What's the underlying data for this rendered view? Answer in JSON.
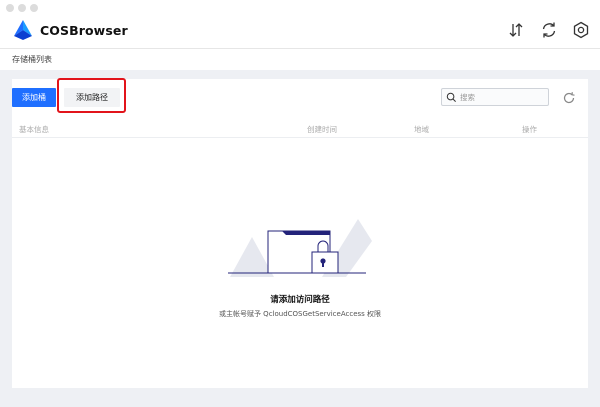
{
  "window": {
    "traffic_lights": [
      "close",
      "minimize",
      "zoom"
    ]
  },
  "header": {
    "app_name": "COSBrowser",
    "logo_icon": "cos-logo-icon",
    "icons": [
      "transfer-icon",
      "sync-icon",
      "settings-icon"
    ]
  },
  "breadcrumb": {
    "label": "存储桶列表"
  },
  "toolbar": {
    "add_bucket_label": "添加桶",
    "add_path_label": "添加路径",
    "search_placeholder": "搜索",
    "refresh_icon": "refresh-icon"
  },
  "table": {
    "columns": [
      "基本信息",
      "创建时间",
      "地域",
      "操作"
    ]
  },
  "empty_state": {
    "title": "请添加访问路径",
    "subtitle": "或主帐号赋予 QcloudCOSGetServiceAccess 权限",
    "illustration": "locked-folder-illustration"
  },
  "colors": {
    "primary": "#1f6fff",
    "highlight": "#e2141b",
    "content_bg": "#eef0f4",
    "illustration_navy": "#23237a"
  }
}
